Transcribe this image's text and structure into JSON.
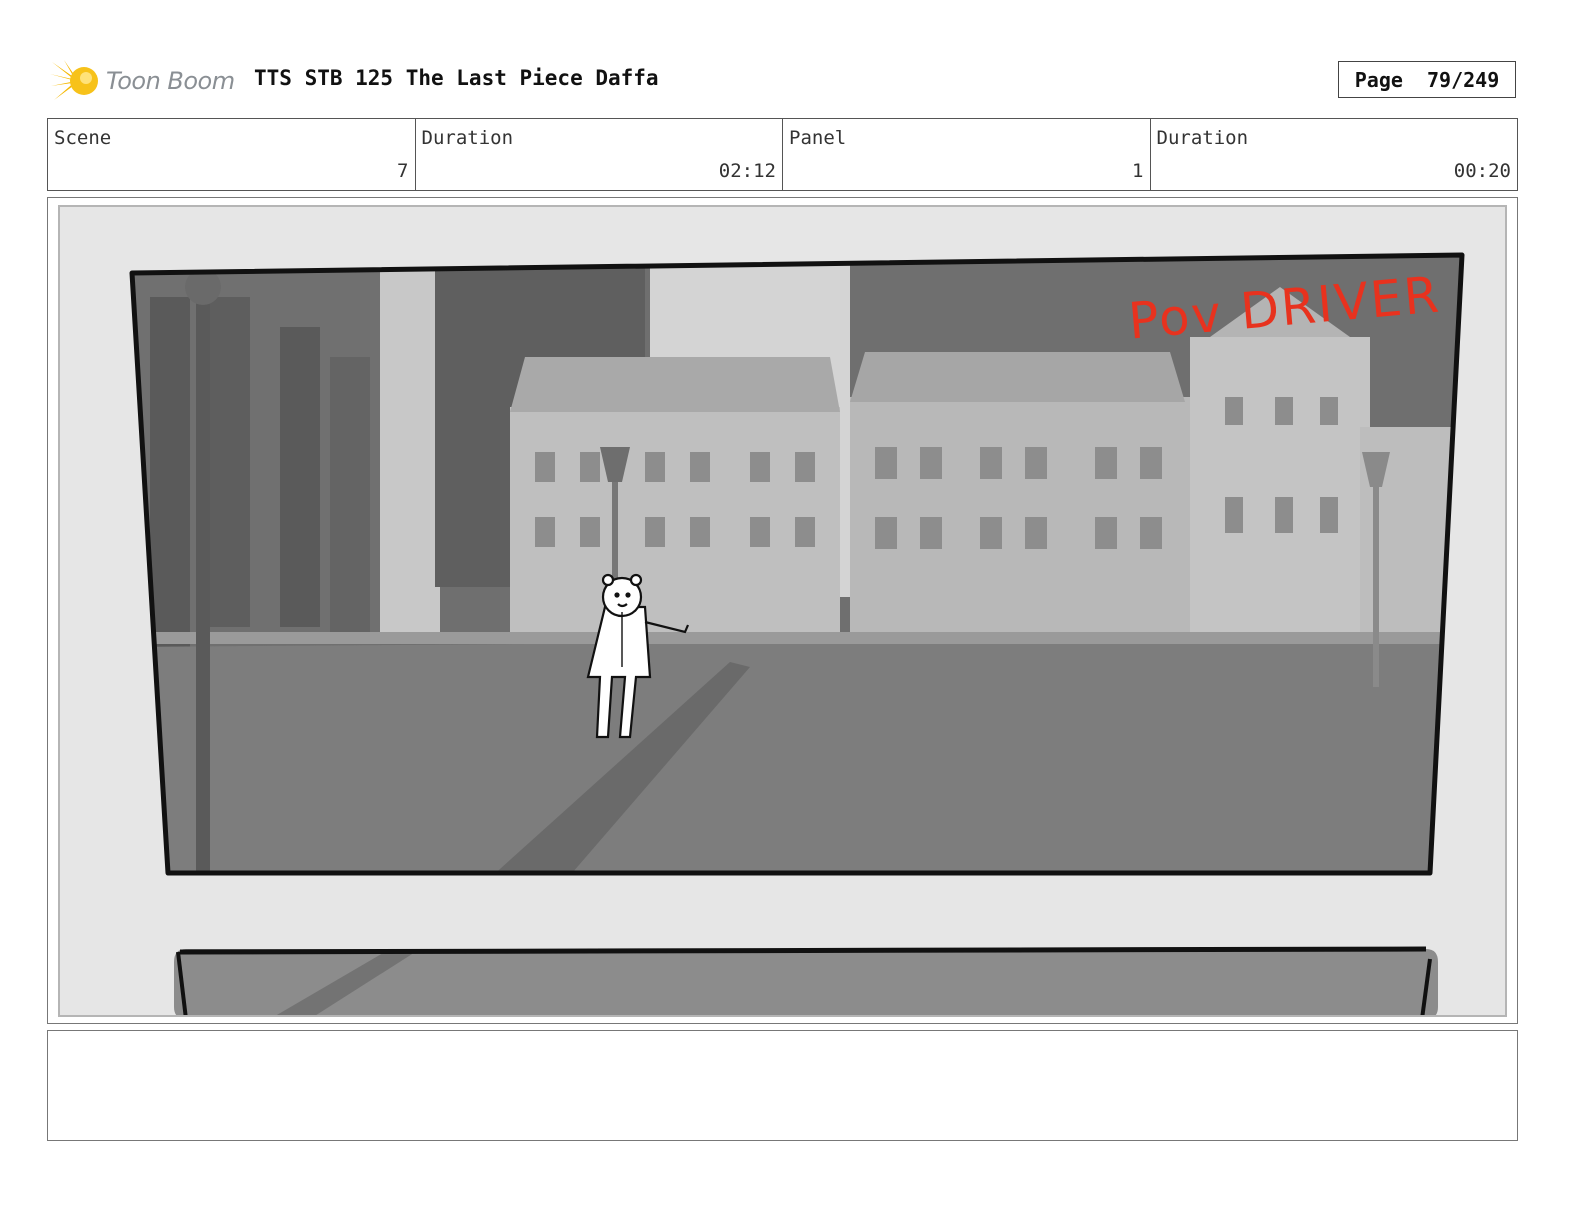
{
  "header": {
    "logo_text": "Toon Boom",
    "project_title": "TTS STB 125 The Last Piece Daffa",
    "page_label": "Page",
    "page_value": "79/249"
  },
  "info": {
    "scene_label": "Scene",
    "scene_value": "7",
    "scene_duration_label": "Duration",
    "scene_duration_value": "02:12",
    "panel_label": "Panel",
    "panel_value": "1",
    "panel_duration_label": "Duration",
    "panel_duration_value": "00:20"
  },
  "panel": {
    "annotation": "Pov DRIVER",
    "annotation_color": "#e8321e"
  },
  "notes": {
    "text": ""
  }
}
